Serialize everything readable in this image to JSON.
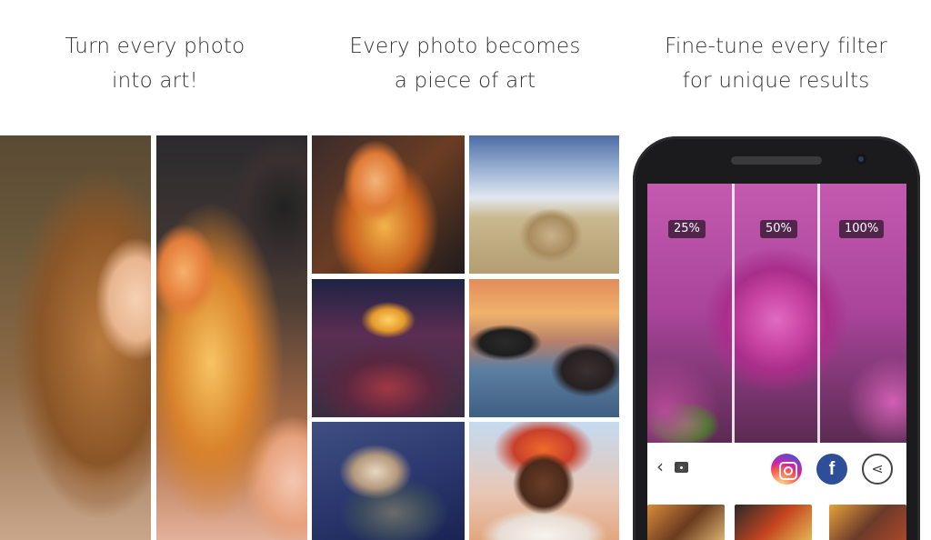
{
  "captions": {
    "panel1": {
      "line1": "Turn every photo",
      "line2": "into art!"
    },
    "panel2": {
      "line1": "Every photo becomes",
      "line2": "a piece of art"
    },
    "panel3": {
      "line1": "Fine-tune every filter",
      "line2": "for unique results"
    }
  },
  "phone": {
    "strength_levels": [
      "25%",
      "50%",
      "100%"
    ],
    "share": {
      "back_glyph": "‹",
      "instagram_icon": "instagram-icon",
      "facebook_glyph": "f",
      "share_glyph": "⋖"
    }
  },
  "colors": {
    "facebook": "#2f4e9a",
    "phone_body": "#1b1b1d",
    "caption_text": "#333333"
  }
}
